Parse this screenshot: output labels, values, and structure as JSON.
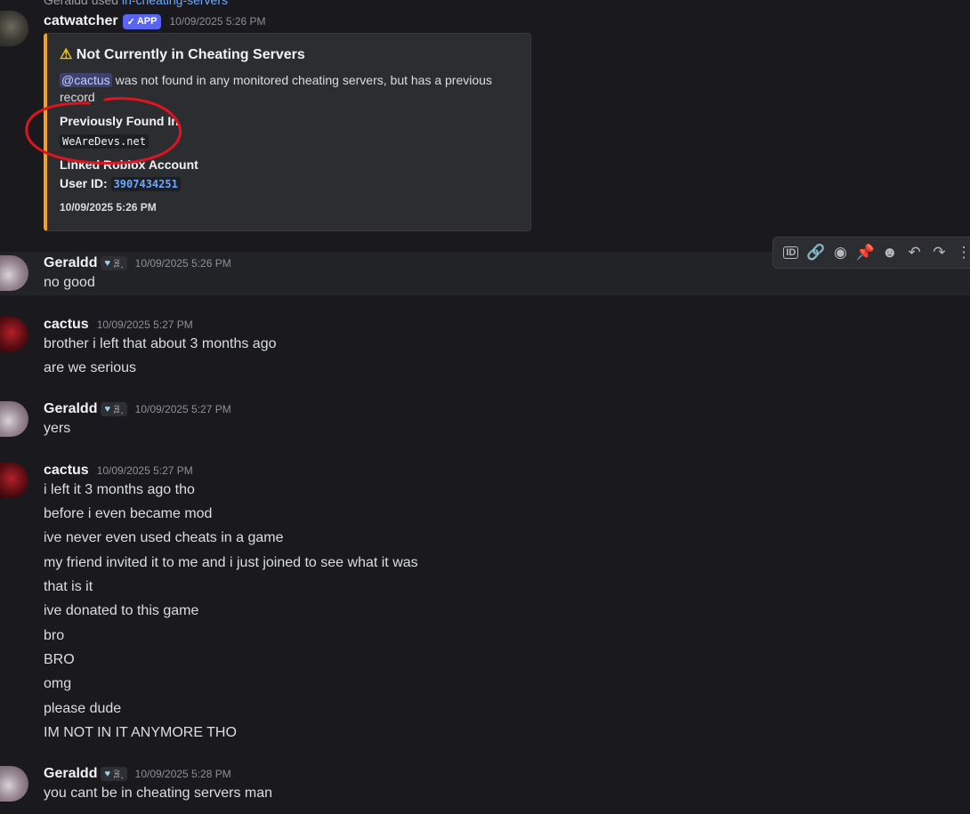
{
  "top_reply": {
    "user": "Geraldd used",
    "command": "in-cheating-servers"
  },
  "bot_message": {
    "username": "catwatcher",
    "badge": "APP",
    "timestamp": "10/09/2025 5:26 PM",
    "embed": {
      "title": "Not Currently in Cheating Servers",
      "mention": "@cactus",
      "description": "was not found in any monitored cheating servers, but has a previous record",
      "field1_name": "Previously Found In",
      "field1_value": "WeAreDevs.net",
      "field2_name": "Linked Roblox Account",
      "field2_label": "User ID:",
      "field2_value": "3907434251",
      "footer": "10/09/2025 5:26 PM",
      "accent_color": "#f0a02a"
    }
  },
  "toolbar": {
    "icons": [
      "id-icon",
      "link-icon",
      "thread-icon",
      "pin-icon",
      "emoji-icon",
      "reply-icon",
      "forward-icon",
      "more-icon"
    ],
    "glyph_id": "ID",
    "glyph_link": "🔗",
    "glyph_thread": "◉",
    "glyph_pin": "📌",
    "glyph_emoji": "☻",
    "glyph_reply": "↶",
    "glyph_forward": "↷",
    "glyph_more": "⋮"
  },
  "messages": [
    {
      "username": "Geraldd",
      "tag": "ꍃ.",
      "timestamp": "10/09/2025 5:26 PM",
      "lines": [
        "no good"
      ]
    },
    {
      "username": "cactus",
      "timestamp": "10/09/2025 5:27 PM",
      "lines": [
        "brother i left that about 3 months ago",
        "are we serious"
      ]
    },
    {
      "username": "Geraldd",
      "tag": "ꍃ.",
      "timestamp": "10/09/2025 5:27 PM",
      "lines": [
        "yers"
      ]
    },
    {
      "username": "cactus",
      "timestamp": "10/09/2025 5:27 PM",
      "lines": [
        "i left it 3 months ago tho",
        "before i even became mod",
        "ive never even used cheats in a game",
        "my friend invited it to me and i just joined to see what it was",
        "that is it",
        "ive donated to this game",
        "bro",
        "BRO",
        "omg",
        "please dude",
        "IM NOT IN IT ANYMORE THO"
      ]
    },
    {
      "username": "Geraldd",
      "tag": "ꍃ.",
      "timestamp": "10/09/2025 5:28 PM",
      "lines": [
        "you cant be in cheating servers man"
      ]
    }
  ],
  "annotation_color": "#e0141e"
}
